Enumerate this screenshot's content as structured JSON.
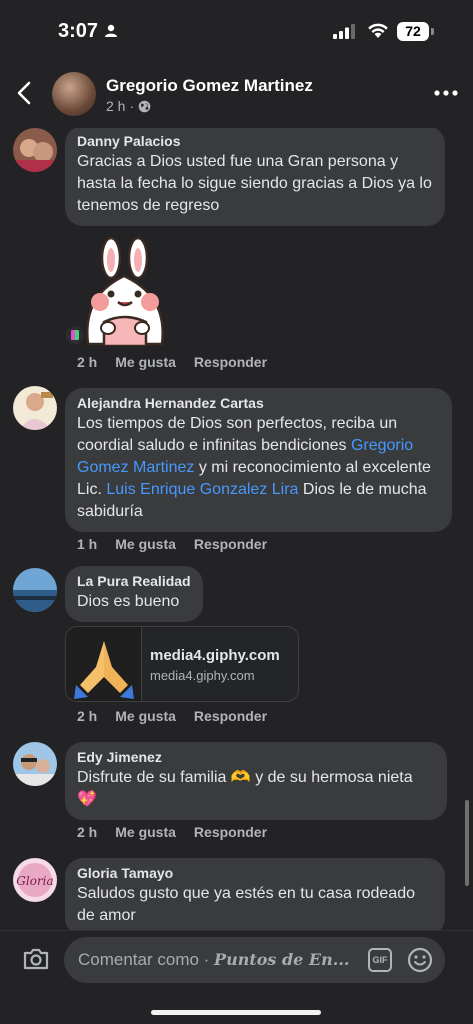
{
  "status_bar": {
    "time": "3:07",
    "battery": "72"
  },
  "header": {
    "name": "Gregorio Gomez Martinez",
    "time_ago": "2 h",
    "dot": "·"
  },
  "actions": {
    "like": "Me gusta",
    "reply": "Responder"
  },
  "comments": [
    {
      "author": "Danny Palacios",
      "text": "Gracias a Dios usted fue una Gran persona y hasta la fecha lo sigue siendo gracias a Dios ya lo tenemos de regreso",
      "time": "2 h"
    },
    {
      "author": "Alejandra Hernandez Cartas",
      "text_1": "Los tiempos de Dios son perfectos, reciba un coordial saludo e infinitas bendiciones ",
      "mention_1": "Gregorio Gomez Martinez",
      "text_2": " y mi reconocimiento al excelente Lic. ",
      "mention_2": "Luis Enrique Gonzalez Lira",
      "text_3": " Dios le de mucha sabiduría",
      "time": "1 h"
    },
    {
      "author": "La Pura Realidad",
      "text": "Dios es bueno",
      "link_title": "media4.giphy.com",
      "link_domain": "media4.giphy.com",
      "time": "2 h"
    },
    {
      "author": "Edy Jimenez",
      "text": "Disfrute de su familia 🫶 y de su hermosa nieta 💖",
      "time": "2 h"
    },
    {
      "author": "Gloria Tamayo",
      "text": "Saludos gusto que ya estés en tu casa rodeado de amor",
      "avatar_label": "Gloria"
    }
  ],
  "composer": {
    "placeholder": "Comentar como · ",
    "page_name": "Puntos de En...",
    "gif": "GIF"
  },
  "icons": {
    "back": "chevron-left-icon",
    "globe": "globe-icon",
    "more": "more-horizontal-icon",
    "camera": "camera-icon",
    "gif": "gif-icon",
    "emoji": "smile-icon",
    "sticker": "sticker-icon"
  },
  "colors": {
    "background": "#232325",
    "bubble": "#3a3b3c",
    "mention": "#4599ff",
    "muted": "#b0b3b8"
  }
}
